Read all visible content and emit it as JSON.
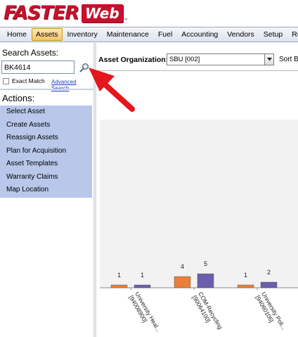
{
  "app": {
    "logo_main": "FASTER",
    "logo_box": "Web",
    "logo_tm": "™"
  },
  "menu": {
    "items": [
      {
        "label": "Home",
        "active": false
      },
      {
        "label": "Assets",
        "active": true
      },
      {
        "label": "Inventory",
        "active": false
      },
      {
        "label": "Maintenance",
        "active": false
      },
      {
        "label": "Fuel",
        "active": false
      },
      {
        "label": "Accounting",
        "active": false
      },
      {
        "label": "Vendors",
        "active": false
      },
      {
        "label": "Setup",
        "active": false
      },
      {
        "label": "Repo",
        "active": false
      }
    ]
  },
  "search": {
    "title": "Search Assets:",
    "value": "BK4614",
    "exact_match_label": "Exact Match",
    "exact_match_checked": false,
    "advanced_link": "Advanced Search",
    "button_icon": "search-icon"
  },
  "actions": {
    "title": "Actions:",
    "items": [
      "Select Asset",
      "Create Assets",
      "Reassign Assets",
      "Plan for Acquisition",
      "Asset Templates",
      "Warranty Claims",
      "Map Location"
    ]
  },
  "organization": {
    "label": "Asset Organization:",
    "selected": "SBU [002]",
    "sort_label": "Sort B"
  },
  "colors": {
    "accent_active_menu": "#f6c36a",
    "actions_bg": "#b8c7ea",
    "series_orange": "#e8803a",
    "series_purple": "#6a5fae",
    "arrow_red": "#e5161c"
  },
  "chart_data": {
    "type": "bar",
    "categories": [
      "University Heal... [94008900]",
      "COM-Recycling [90064100]",
      "University Poli... [94060106]"
    ],
    "series": [
      {
        "color": "#e8803a",
        "values": [
          1,
          4,
          1
        ]
      },
      {
        "color": "#6a5fae",
        "values": [
          1,
          5,
          2
        ]
      }
    ],
    "ylim": [
      0,
      60
    ],
    "grid": false,
    "legend": "none"
  }
}
